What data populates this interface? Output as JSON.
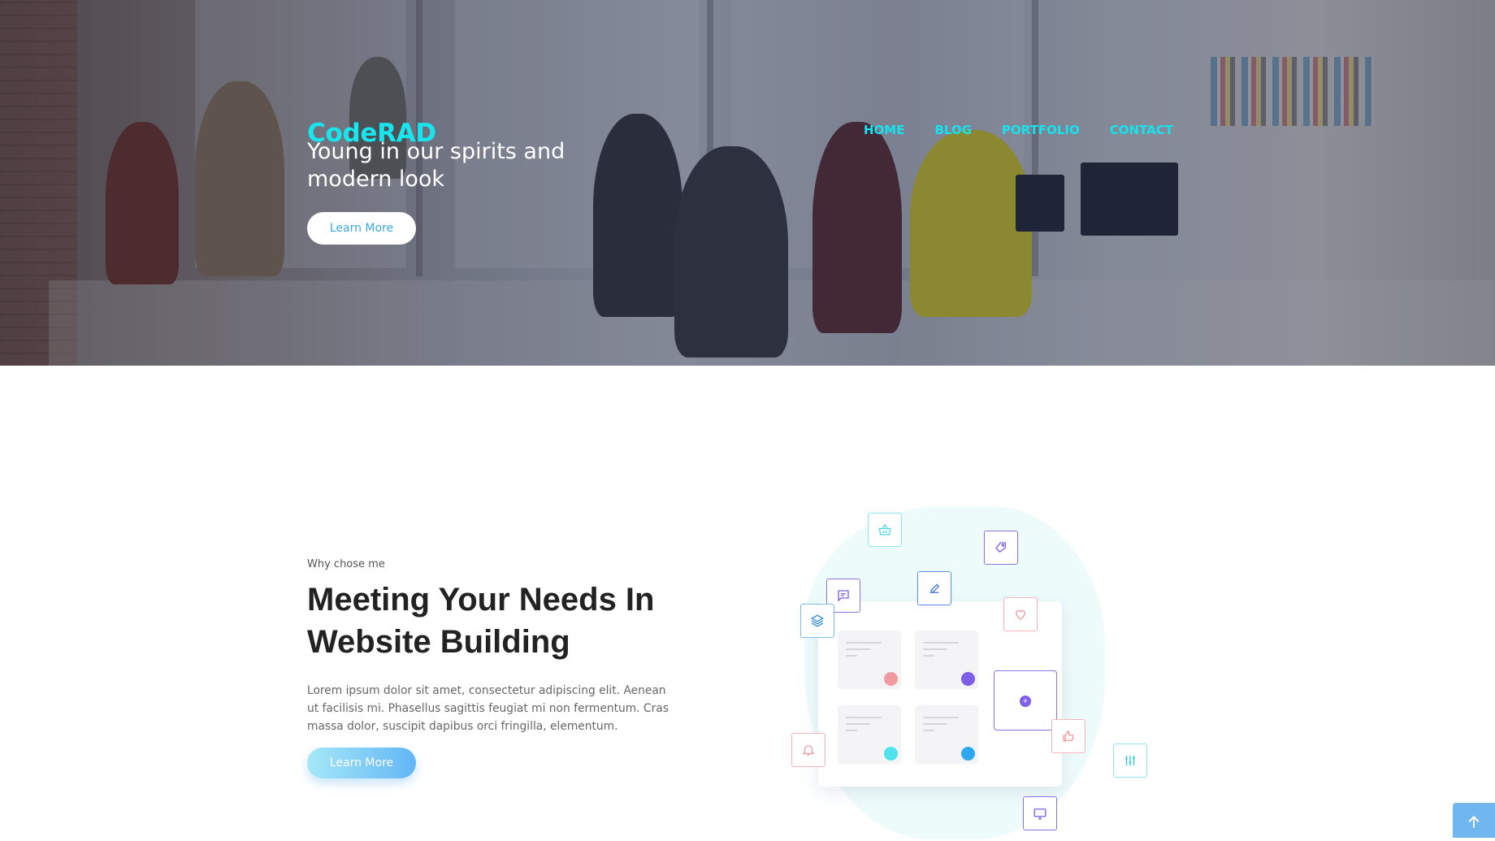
{
  "header": {
    "brand": "CodeRAD",
    "tagline": "Young in our spirits and modern look",
    "hero_button": "Learn More",
    "nav": [
      "HOME",
      "BLOG",
      "PORTFOLIO",
      "CONTACT"
    ]
  },
  "features": {
    "eyebrow": "Why chose me",
    "heading": "Meeting Your Needs In Website Building",
    "paragraph": "Lorem ipsum dolor sit amet, consectetur adipiscing elit. Aenean ut facilisis mi. Phasellus sagittis feugiat mi non fermentum. Cras massa dolor, suscipit dapibus orci fringilla, elementum.",
    "button": "Learn More"
  },
  "colors": {
    "brand_cyan": "#17e6ef",
    "button_text_blue": "#3aa7e4",
    "heading_dark": "#222222",
    "accent_purple": "#7d5fe8",
    "accent_pink": "#f09aa0",
    "accent_cyan": "#4fe3ee",
    "accent_blue": "#2fa8f2"
  },
  "illustration_icons": [
    "basket-icon",
    "tag-icon",
    "message-icon",
    "edit-icon",
    "heart-icon",
    "layers-icon",
    "plus-icon",
    "like-icon",
    "bell-icon",
    "sliders-icon",
    "monitor-icon"
  ],
  "scroll_top_icon": "arrow-up-icon"
}
